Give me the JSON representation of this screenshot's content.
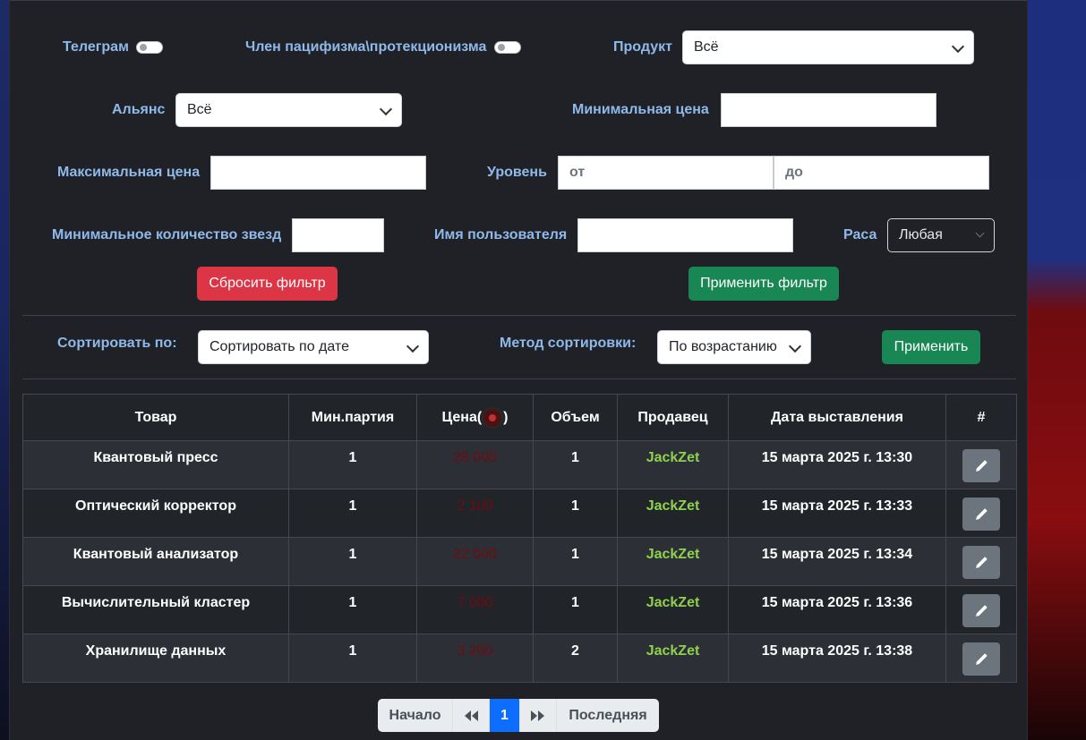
{
  "filters": {
    "telegram_label": "Телеграм",
    "pacifism_label": "Член пацифизма\\протекционизма",
    "product_label": "Продукт",
    "product_value": "Всё",
    "alliance_label": "Альянс",
    "alliance_value": "Всё",
    "min_price_label": "Минимальная цена",
    "max_price_label": "Максимальная цена",
    "level_label": "Уровень",
    "level_from_placeholder": "от",
    "level_to_placeholder": "до",
    "min_stars_label": "Минимальное количество звезд",
    "username_label": "Имя пользователя",
    "race_label": "Раса",
    "race_value": "Любая",
    "reset_button": "Сбросить фильтр",
    "apply_button": "Применить фильтр"
  },
  "sort": {
    "sort_by_label": "Сортировать по:",
    "sort_by_value": "Сортировать по дате",
    "method_label": "Метод сортировки:",
    "method_value": "По возрастанию",
    "apply_button": "Применить"
  },
  "table": {
    "headers": {
      "item": "Товар",
      "min_batch": "Мин.партия",
      "price_prefix": "Цена(",
      "price_suffix": ")",
      "volume": "Объем",
      "seller": "Продавец",
      "date": "Дата выставления",
      "actions": "#"
    },
    "rows": [
      {
        "item": "Квантовый пресс",
        "min_batch": "1",
        "price": "28 000",
        "volume": "1",
        "seller": "JackZet",
        "date": "15 марта 2025 г. 13:30"
      },
      {
        "item": "Оптический корректор",
        "min_batch": "1",
        "price": "2 100",
        "volume": "1",
        "seller": "JackZet",
        "date": "15 марта 2025 г. 13:33"
      },
      {
        "item": "Квантовый анализатор",
        "min_batch": "1",
        "price": "22 000",
        "volume": "1",
        "seller": "JackZet",
        "date": "15 марта 2025 г. 13:34"
      },
      {
        "item": "Вычислительный кластер",
        "min_batch": "1",
        "price": "7 000",
        "volume": "1",
        "seller": "JackZet",
        "date": "15 марта 2025 г. 13:36"
      },
      {
        "item": "Хранилище данных",
        "min_batch": "1",
        "price": "3 200",
        "volume": "2",
        "seller": "JackZet",
        "date": "15 марта 2025 г. 13:38"
      }
    ]
  },
  "pagination": {
    "first": "Начало",
    "current": "1",
    "last": "Последняя"
  },
  "icons": {
    "edit": "pencil-icon",
    "currency": "coin-icon",
    "prev": "double-chevron-left-icon",
    "next": "double-chevron-right-icon"
  }
}
